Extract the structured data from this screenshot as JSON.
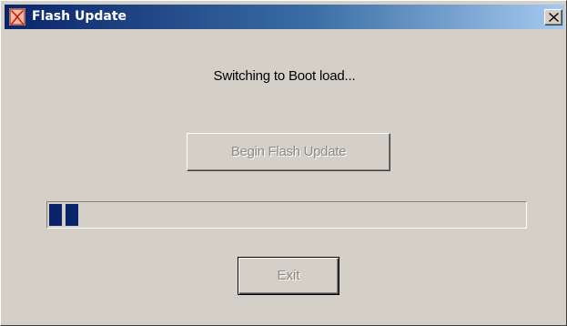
{
  "window": {
    "title": "Flash Update",
    "icon": "flash-app-icon",
    "close_icon": "close-icon"
  },
  "main": {
    "status_text": "Switching to Boot load...",
    "begin_button_label": "Begin Flash Update",
    "begin_button_enabled": false,
    "progress_fraction": 0.07,
    "exit_button_label": "Exit",
    "exit_button_enabled": false
  },
  "colors": {
    "titlebar_start": "#0a246a",
    "titlebar_end": "#a6caf0",
    "progress_fill": "#0a246a",
    "face": "#d4d0c8",
    "disabled_text": "#8c8a86"
  }
}
